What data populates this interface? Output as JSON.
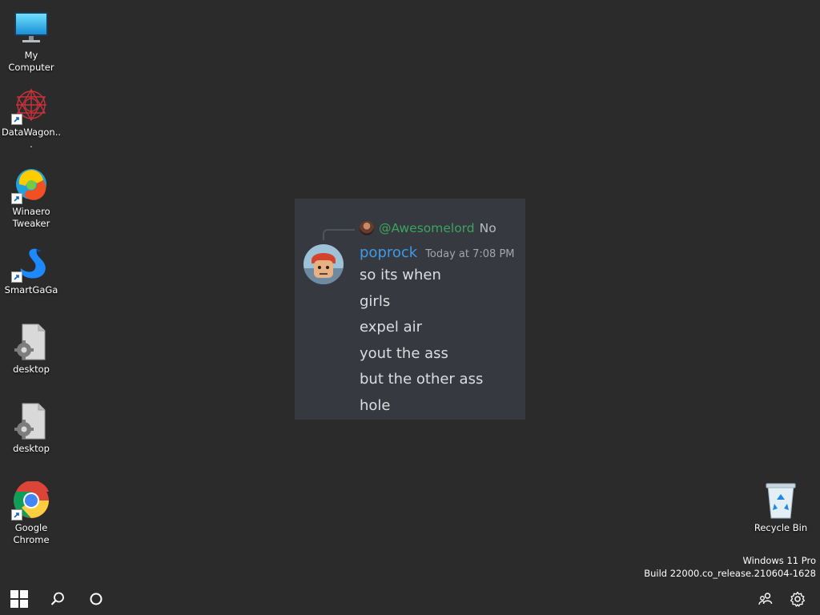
{
  "desktop": {
    "icons": [
      {
        "label": "My Computer",
        "icon": "monitor-icon",
        "shortcut": false
      },
      {
        "label": "DataWagon...",
        "icon": "datawagon-icon",
        "shortcut": true
      },
      {
        "label": "Winaero Tweaker",
        "icon": "winaero-tweaker-icon",
        "shortcut": true
      },
      {
        "label": "SmartGaGa",
        "icon": "smartgaga-icon",
        "shortcut": true
      },
      {
        "label": "desktop",
        "icon": "settings-file-icon",
        "shortcut": false
      },
      {
        "label": "desktop",
        "icon": "settings-file-icon",
        "shortcut": false
      },
      {
        "label": "Google Chrome",
        "icon": "chrome-icon",
        "shortcut": true
      }
    ],
    "recycle_bin": {
      "label": "Recycle Bin",
      "icon": "recycle-bin-icon"
    }
  },
  "chat": {
    "reply": {
      "username": "@Awesomelord",
      "text": "No"
    },
    "message": {
      "username": "poprock",
      "timestamp": "Today at 7:08 PM",
      "lines": [
        "so its when",
        "girls",
        "expel air",
        "yout the ass",
        "but the other ass",
        "hole"
      ]
    },
    "colors": {
      "background": "#36393f",
      "username": "#3f9ae6",
      "mention": "#3ba55d",
      "text": "#dcddde"
    }
  },
  "watermark": {
    "edition": "Windows 11 Pro",
    "build": "Build 22000.co_release.210604-1628"
  },
  "taskbar": {
    "left": [
      "windows-logo-icon",
      "search-icon",
      "cortana-icon"
    ],
    "right": [
      "people-icon",
      "settings-gear-icon"
    ]
  }
}
